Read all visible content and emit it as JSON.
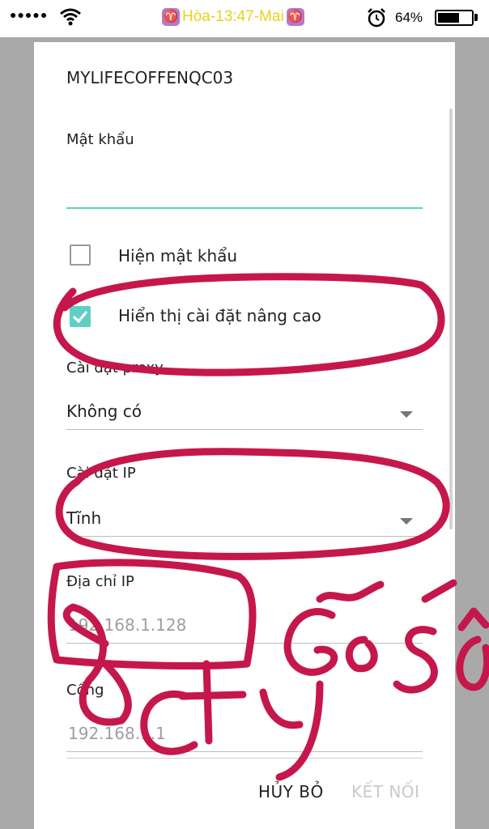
{
  "status_bar": {
    "signal": "●●●●●",
    "carrier": "Hòa-13:47-Mai",
    "zodiac_glyph": "♈",
    "battery_percent": "64%",
    "battery_level": 0.64
  },
  "dialog": {
    "network_name": "MYLIFECOFFENQC03",
    "password_label": "Mật khẩu",
    "password_value": "",
    "show_password_label": "Hiện mật khẩu",
    "show_password_checked": false,
    "advanced_label": "Hiển thị cài đặt nâng cao",
    "advanced_checked": true,
    "proxy_label": "Cài đặt proxy",
    "proxy_value": "Không có",
    "ip_settings_label": "Cài đặt IP",
    "ip_settings_value": "Tĩnh",
    "ip_address_label": "Địa chỉ IP",
    "ip_address_placeholder": "192.168.1.128",
    "gateway_label": "Cổng",
    "gateway_placeholder": "192.168.1.1",
    "cancel_label": "HỦY BỎ",
    "connect_label": "KẾT NỐI"
  },
  "colors": {
    "accent": "#5fd0c3",
    "annotation_ink": "#c5174b",
    "carrier_text": "#e8d21a",
    "disabled_text": "#c9c9c9"
  }
}
